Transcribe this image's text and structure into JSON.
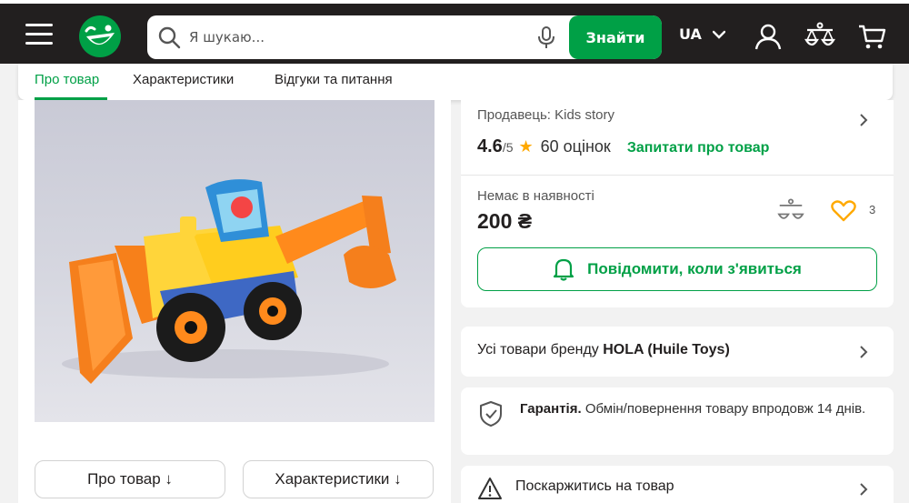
{
  "header": {
    "search_placeholder": "Я шукаю...",
    "search_button": "Знайти",
    "language": "UA",
    "brand_color": "#00a046",
    "icons": [
      "menu-icon",
      "smile-logo-icon",
      "search-icon",
      "microphone-icon",
      "chevron-down-icon",
      "user-icon",
      "compare-scales-icon",
      "cart-icon"
    ]
  },
  "tabs": [
    {
      "label": "Про товар",
      "active": true
    },
    {
      "label": "Характеристики",
      "active": false
    },
    {
      "label": "Відгуки та питання",
      "active": false
    }
  ],
  "product": {
    "seller": "Продавець: Kids story",
    "rating": "4.6",
    "rating_max": "/5",
    "rating_count": "60 оцінок",
    "ask_link": "Запитати про товар",
    "stock_status": "Немає в наявності",
    "price": "200 ₴",
    "wishlist_count": "3",
    "notify_button": "Повідомити, коли з'явиться"
  },
  "left_buttons": {
    "about": "Про товар ↓",
    "specs": "Характеристики ↓"
  },
  "brand_card": {
    "prefix": "Усі товари бренду ",
    "brand": "HOLA (Huile Toys)"
  },
  "guarantee": {
    "title": "Гарантія.",
    "text": " Обмін/повернення товару впродовж 14 днів."
  },
  "complaint": {
    "label": "Поскаржитись на товар"
  }
}
